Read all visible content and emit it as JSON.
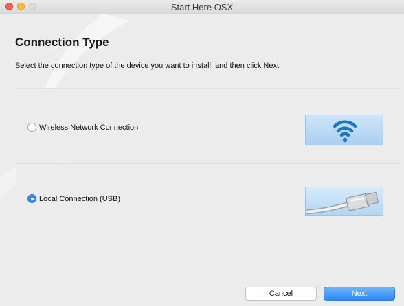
{
  "window": {
    "title": "Start Here OSX"
  },
  "page": {
    "heading": "Connection Type",
    "instruction": "Select the connection type of the device you want to install, and then click Next."
  },
  "options": [
    {
      "label": "Wireless Network Connection",
      "selected": false,
      "icon": "wifi-icon"
    },
    {
      "label": "Local Connection (USB)",
      "selected": true,
      "icon": "usb-cable-icon"
    }
  ],
  "buttons": {
    "cancel": "Cancel",
    "next": "Next"
  },
  "colors": {
    "accent": "#3d8cf5",
    "next_button": "#2f8af4",
    "traffic_close": "#fc5f57",
    "traffic_min": "#fdbc2e"
  }
}
